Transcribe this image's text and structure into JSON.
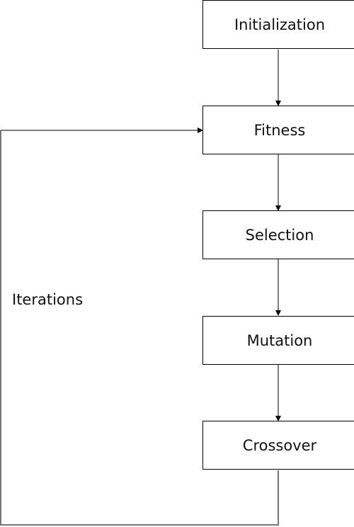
{
  "diagram": {
    "nodes": [
      {
        "id": "initialization",
        "label": "Initialization"
      },
      {
        "id": "fitness",
        "label": "Fitness"
      },
      {
        "id": "selection",
        "label": "Selection"
      },
      {
        "id": "mutation",
        "label": "Mutation"
      },
      {
        "id": "crossover",
        "label": "Crossover"
      }
    ],
    "edges": [
      {
        "from": "initialization",
        "to": "fitness"
      },
      {
        "from": "fitness",
        "to": "selection"
      },
      {
        "from": "selection",
        "to": "mutation"
      },
      {
        "from": "mutation",
        "to": "crossover"
      },
      {
        "from": "crossover",
        "to": "fitness",
        "label": "Iterations"
      }
    ],
    "loop_label": "Iterations"
  }
}
